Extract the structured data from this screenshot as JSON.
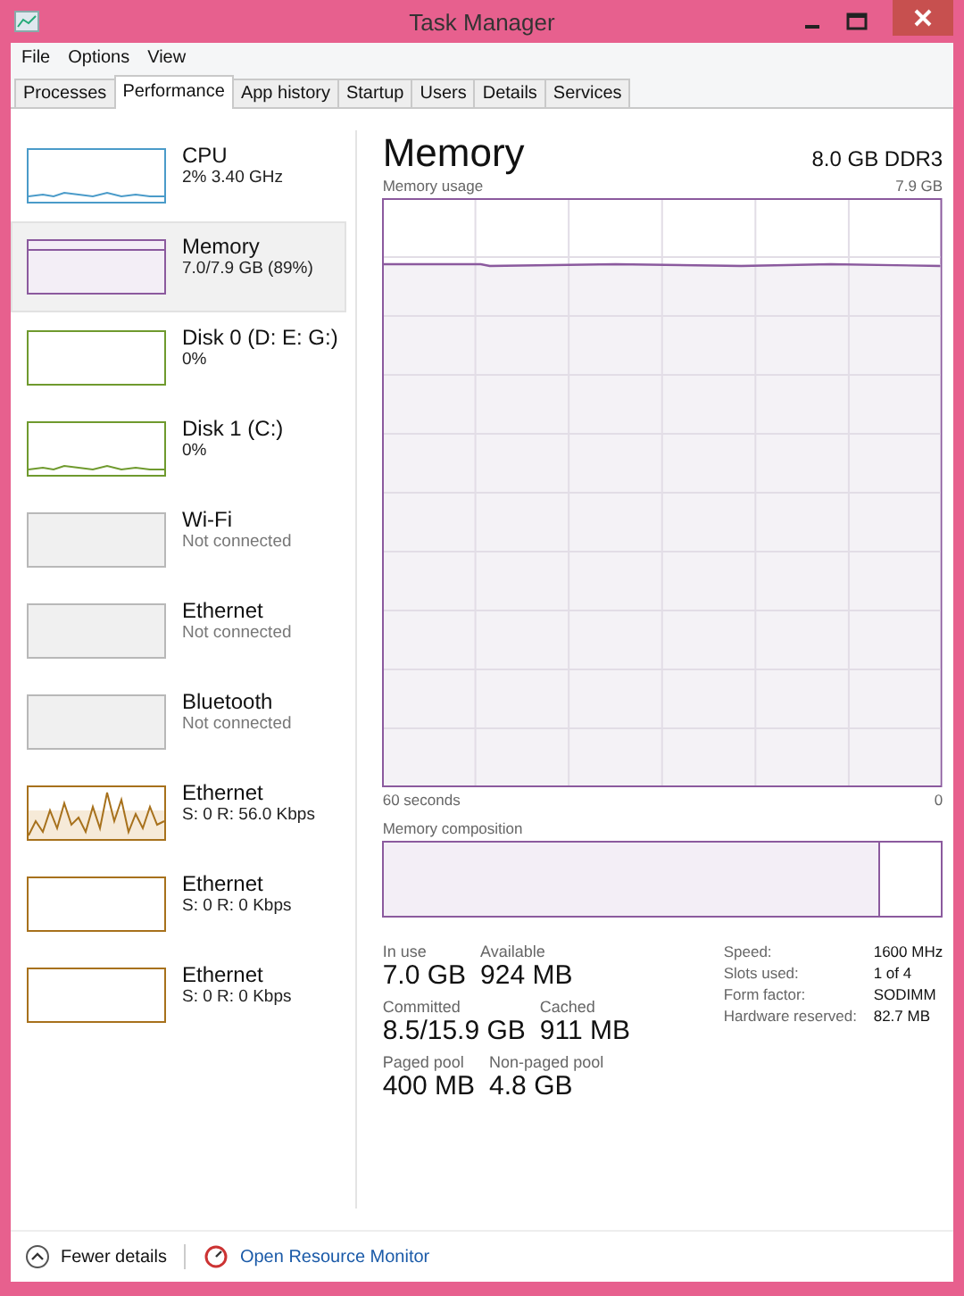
{
  "window": {
    "title": "Task Manager"
  },
  "menu": [
    "File",
    "Options",
    "View"
  ],
  "tabs": [
    {
      "label": "Processes",
      "selected": false
    },
    {
      "label": "Performance",
      "selected": true
    },
    {
      "label": "App history",
      "selected": false
    },
    {
      "label": "Startup",
      "selected": false
    },
    {
      "label": "Users",
      "selected": false
    },
    {
      "label": "Details",
      "selected": false
    },
    {
      "label": "Services",
      "selected": false
    }
  ],
  "sidebar": {
    "items": [
      {
        "name": "CPU",
        "detail": "2%  3.40 GHz",
        "color": "#4a9bc9",
        "kind": "low",
        "selected": false
      },
      {
        "name": "Memory",
        "detail": "7.0/7.9 GB (89%)",
        "color": "#8b5a9e",
        "kind": "memory",
        "selected": true
      },
      {
        "name": "Disk 0 (D: E: G:)",
        "detail": "0%",
        "color": "#6f9a2e",
        "kind": "idle",
        "selected": false
      },
      {
        "name": "Disk 1 (C:)",
        "detail": "0%",
        "color": "#6f9a2e",
        "kind": "low",
        "selected": false
      },
      {
        "name": "Wi-Fi",
        "detail": "Not connected",
        "color": "#b8b8b8",
        "kind": "offline",
        "selected": false
      },
      {
        "name": "Ethernet",
        "detail": "Not connected",
        "color": "#b8b8b8",
        "kind": "offline",
        "selected": false
      },
      {
        "name": "Bluetooth",
        "detail": "Not connected",
        "color": "#b8b8b8",
        "kind": "offline",
        "selected": false
      },
      {
        "name": "Ethernet",
        "detail": "S: 0 R: 56.0 Kbps",
        "color": "#a7711c",
        "kind": "high",
        "selected": false
      },
      {
        "name": "Ethernet",
        "detail": "S: 0 R: 0 Kbps",
        "color": "#a7711c",
        "kind": "idle",
        "selected": false
      },
      {
        "name": "Ethernet",
        "detail": "S: 0 R: 0 Kbps",
        "color": "#a7711c",
        "kind": "idle",
        "selected": false
      }
    ]
  },
  "panel": {
    "title": "Memory",
    "subtitle": "8.0 GB DDR3",
    "usage_label": "Memory usage",
    "usage_max": "7.9 GB",
    "time_span": "60 seconds",
    "time_end": "0",
    "composition_label": "Memory composition",
    "composition": {
      "level": 0.89
    },
    "stats": [
      {
        "label": "In use",
        "value": "7.0 GB"
      },
      {
        "label": "Available",
        "value": "924 MB"
      },
      {
        "label": "Committed",
        "value": "8.5/15.9 GB"
      },
      {
        "label": "Cached",
        "value": "911 MB"
      },
      {
        "label": "Paged pool",
        "value": "400 MB"
      },
      {
        "label": "Non-paged pool",
        "value": "4.8 GB"
      }
    ],
    "details": [
      {
        "label": "Speed:",
        "value": "1600 MHz"
      },
      {
        "label": "Slots used:",
        "value": "1 of 4"
      },
      {
        "label": "Form factor:",
        "value": "SODIMM"
      },
      {
        "label": "Hardware reserved:",
        "value": "82.7 MB"
      }
    ]
  },
  "footer": {
    "fewer_details": "Fewer details",
    "resource_monitor": "Open Resource Monitor"
  }
}
